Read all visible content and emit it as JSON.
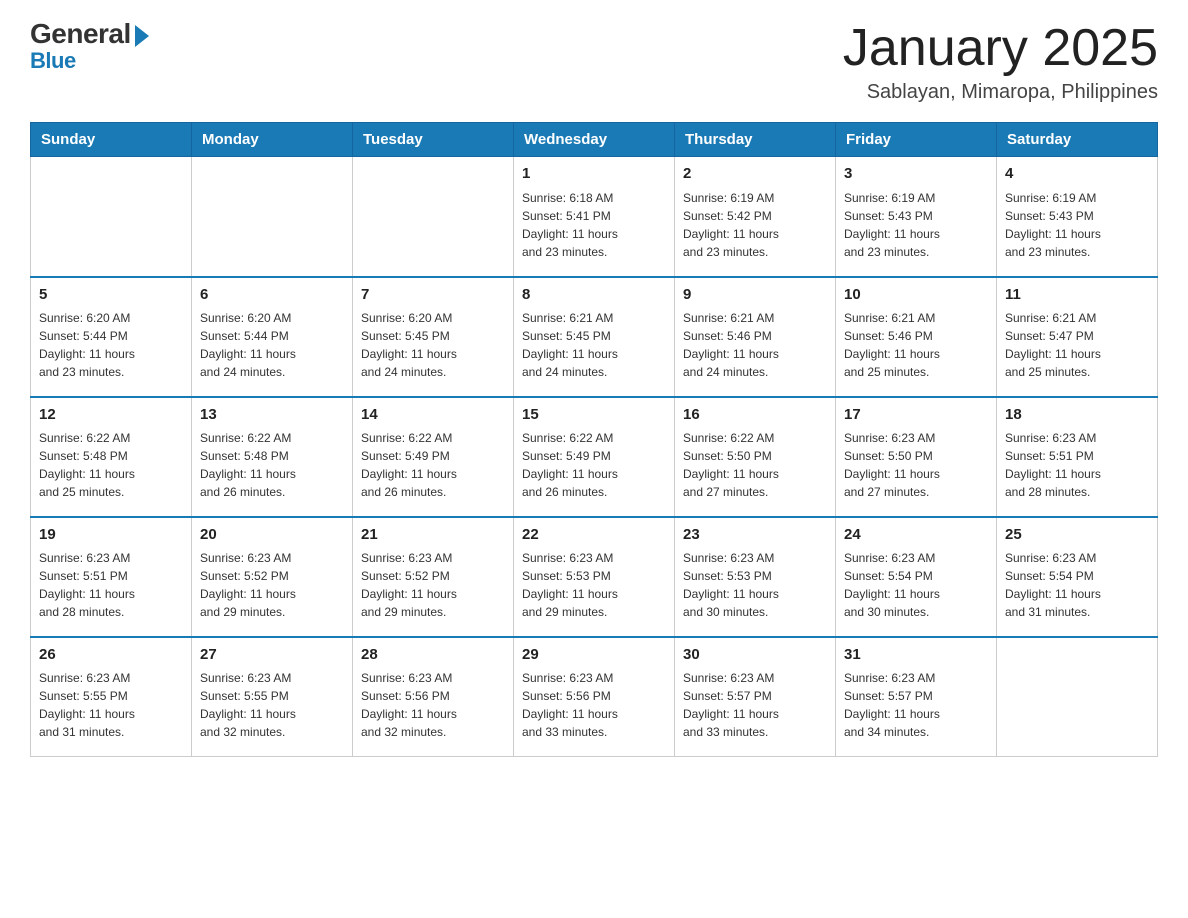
{
  "logo": {
    "general": "General",
    "blue": "Blue"
  },
  "title": "January 2025",
  "subtitle": "Sablayan, Mimaropa, Philippines",
  "days_of_week": [
    "Sunday",
    "Monday",
    "Tuesday",
    "Wednesday",
    "Thursday",
    "Friday",
    "Saturday"
  ],
  "weeks": [
    [
      {
        "day": "",
        "info": ""
      },
      {
        "day": "",
        "info": ""
      },
      {
        "day": "",
        "info": ""
      },
      {
        "day": "1",
        "info": "Sunrise: 6:18 AM\nSunset: 5:41 PM\nDaylight: 11 hours\nand 23 minutes."
      },
      {
        "day": "2",
        "info": "Sunrise: 6:19 AM\nSunset: 5:42 PM\nDaylight: 11 hours\nand 23 minutes."
      },
      {
        "day": "3",
        "info": "Sunrise: 6:19 AM\nSunset: 5:43 PM\nDaylight: 11 hours\nand 23 minutes."
      },
      {
        "day": "4",
        "info": "Sunrise: 6:19 AM\nSunset: 5:43 PM\nDaylight: 11 hours\nand 23 minutes."
      }
    ],
    [
      {
        "day": "5",
        "info": "Sunrise: 6:20 AM\nSunset: 5:44 PM\nDaylight: 11 hours\nand 23 minutes."
      },
      {
        "day": "6",
        "info": "Sunrise: 6:20 AM\nSunset: 5:44 PM\nDaylight: 11 hours\nand 24 minutes."
      },
      {
        "day": "7",
        "info": "Sunrise: 6:20 AM\nSunset: 5:45 PM\nDaylight: 11 hours\nand 24 minutes."
      },
      {
        "day": "8",
        "info": "Sunrise: 6:21 AM\nSunset: 5:45 PM\nDaylight: 11 hours\nand 24 minutes."
      },
      {
        "day": "9",
        "info": "Sunrise: 6:21 AM\nSunset: 5:46 PM\nDaylight: 11 hours\nand 24 minutes."
      },
      {
        "day": "10",
        "info": "Sunrise: 6:21 AM\nSunset: 5:46 PM\nDaylight: 11 hours\nand 25 minutes."
      },
      {
        "day": "11",
        "info": "Sunrise: 6:21 AM\nSunset: 5:47 PM\nDaylight: 11 hours\nand 25 minutes."
      }
    ],
    [
      {
        "day": "12",
        "info": "Sunrise: 6:22 AM\nSunset: 5:48 PM\nDaylight: 11 hours\nand 25 minutes."
      },
      {
        "day": "13",
        "info": "Sunrise: 6:22 AM\nSunset: 5:48 PM\nDaylight: 11 hours\nand 26 minutes."
      },
      {
        "day": "14",
        "info": "Sunrise: 6:22 AM\nSunset: 5:49 PM\nDaylight: 11 hours\nand 26 minutes."
      },
      {
        "day": "15",
        "info": "Sunrise: 6:22 AM\nSunset: 5:49 PM\nDaylight: 11 hours\nand 26 minutes."
      },
      {
        "day": "16",
        "info": "Sunrise: 6:22 AM\nSunset: 5:50 PM\nDaylight: 11 hours\nand 27 minutes."
      },
      {
        "day": "17",
        "info": "Sunrise: 6:23 AM\nSunset: 5:50 PM\nDaylight: 11 hours\nand 27 minutes."
      },
      {
        "day": "18",
        "info": "Sunrise: 6:23 AM\nSunset: 5:51 PM\nDaylight: 11 hours\nand 28 minutes."
      }
    ],
    [
      {
        "day": "19",
        "info": "Sunrise: 6:23 AM\nSunset: 5:51 PM\nDaylight: 11 hours\nand 28 minutes."
      },
      {
        "day": "20",
        "info": "Sunrise: 6:23 AM\nSunset: 5:52 PM\nDaylight: 11 hours\nand 29 minutes."
      },
      {
        "day": "21",
        "info": "Sunrise: 6:23 AM\nSunset: 5:52 PM\nDaylight: 11 hours\nand 29 minutes."
      },
      {
        "day": "22",
        "info": "Sunrise: 6:23 AM\nSunset: 5:53 PM\nDaylight: 11 hours\nand 29 minutes."
      },
      {
        "day": "23",
        "info": "Sunrise: 6:23 AM\nSunset: 5:53 PM\nDaylight: 11 hours\nand 30 minutes."
      },
      {
        "day": "24",
        "info": "Sunrise: 6:23 AM\nSunset: 5:54 PM\nDaylight: 11 hours\nand 30 minutes."
      },
      {
        "day": "25",
        "info": "Sunrise: 6:23 AM\nSunset: 5:54 PM\nDaylight: 11 hours\nand 31 minutes."
      }
    ],
    [
      {
        "day": "26",
        "info": "Sunrise: 6:23 AM\nSunset: 5:55 PM\nDaylight: 11 hours\nand 31 minutes."
      },
      {
        "day": "27",
        "info": "Sunrise: 6:23 AM\nSunset: 5:55 PM\nDaylight: 11 hours\nand 32 minutes."
      },
      {
        "day": "28",
        "info": "Sunrise: 6:23 AM\nSunset: 5:56 PM\nDaylight: 11 hours\nand 32 minutes."
      },
      {
        "day": "29",
        "info": "Sunrise: 6:23 AM\nSunset: 5:56 PM\nDaylight: 11 hours\nand 33 minutes."
      },
      {
        "day": "30",
        "info": "Sunrise: 6:23 AM\nSunset: 5:57 PM\nDaylight: 11 hours\nand 33 minutes."
      },
      {
        "day": "31",
        "info": "Sunrise: 6:23 AM\nSunset: 5:57 PM\nDaylight: 11 hours\nand 34 minutes."
      },
      {
        "day": "",
        "info": ""
      }
    ]
  ]
}
